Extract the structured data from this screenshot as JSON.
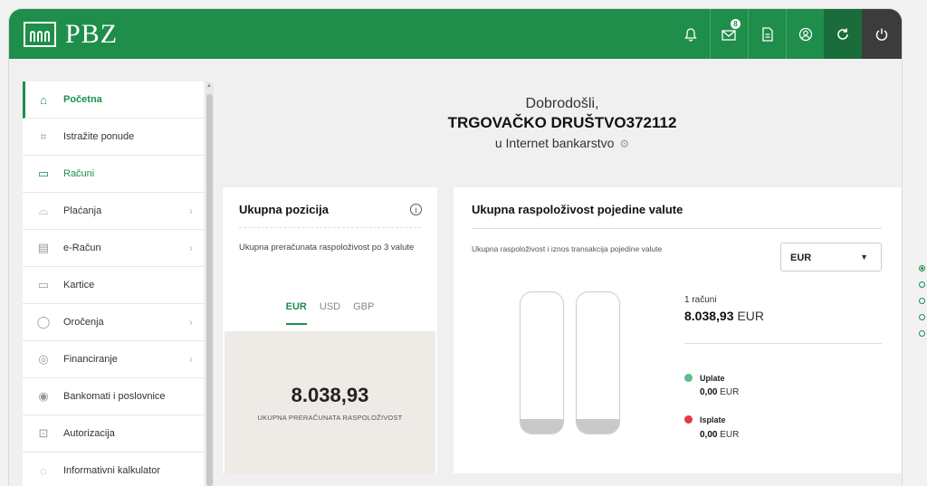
{
  "header": {
    "logo_text": "PBZ",
    "icons": [
      "bell-icon",
      "mail-icon",
      "document-icon",
      "user-icon",
      "refresh-icon",
      "power-icon"
    ],
    "mail_badge": "8"
  },
  "sidebar": {
    "items": [
      {
        "label": "Početna",
        "icon": "home-icon",
        "active": true,
        "chevron": false
      },
      {
        "label": "Istražite ponude",
        "icon": "tag-icon",
        "chevron": false
      },
      {
        "label": "Računi",
        "icon": "wallet-icon",
        "chevron": false
      },
      {
        "label": "Plaćanja",
        "icon": "payment-icon",
        "chevron": true
      },
      {
        "label": "e-Račun",
        "icon": "ebill-icon",
        "chevron": true
      },
      {
        "label": "Kartice",
        "icon": "card-icon",
        "chevron": false
      },
      {
        "label": "Oročenja",
        "icon": "savings-icon",
        "chevron": true
      },
      {
        "label": "Financiranje",
        "icon": "finance-icon",
        "chevron": true
      },
      {
        "label": "Bankomati i poslovnice",
        "icon": "location-icon",
        "chevron": false
      },
      {
        "label": "Autorizacija",
        "icon": "lock-icon",
        "chevron": false
      },
      {
        "label": "Informativni kalkulator",
        "icon": "calculator-icon",
        "chevron": false
      }
    ]
  },
  "welcome": {
    "greeting": "Dobrodošli,",
    "company": "TRGOVAČKO DRUŠTVO372112",
    "subtitle": "u Internet bankarstvo"
  },
  "position_card": {
    "title": "Ukupna pozicija",
    "description": "Ukupna preračunata raspoloživost po 3 valute",
    "tabs": [
      "EUR",
      "USD",
      "GBP"
    ],
    "active_tab": "EUR",
    "value": "8.038,93",
    "value_label": "UKUPNA PRERAČUNATA RASPOLOŽIVOST"
  },
  "currency_card": {
    "title": "Ukupna raspoloživost pojedine valute",
    "description": "Ukupna raspoloživost i iznos transakcija pojedine valute",
    "selected_currency": "EUR",
    "accounts_count": "1 računi",
    "amount": "8.038,93",
    "amount_currency": "EUR",
    "bar_levels": [
      0.1,
      0.1
    ],
    "legend": [
      {
        "label": "Uplate",
        "value": "0,00",
        "currency": "EUR",
        "color": "#5cbf8c"
      },
      {
        "label": "Isplate",
        "value": "0,00",
        "currency": "EUR",
        "color": "#e53945"
      }
    ]
  },
  "carousel": {
    "count": 5,
    "active": 0
  }
}
